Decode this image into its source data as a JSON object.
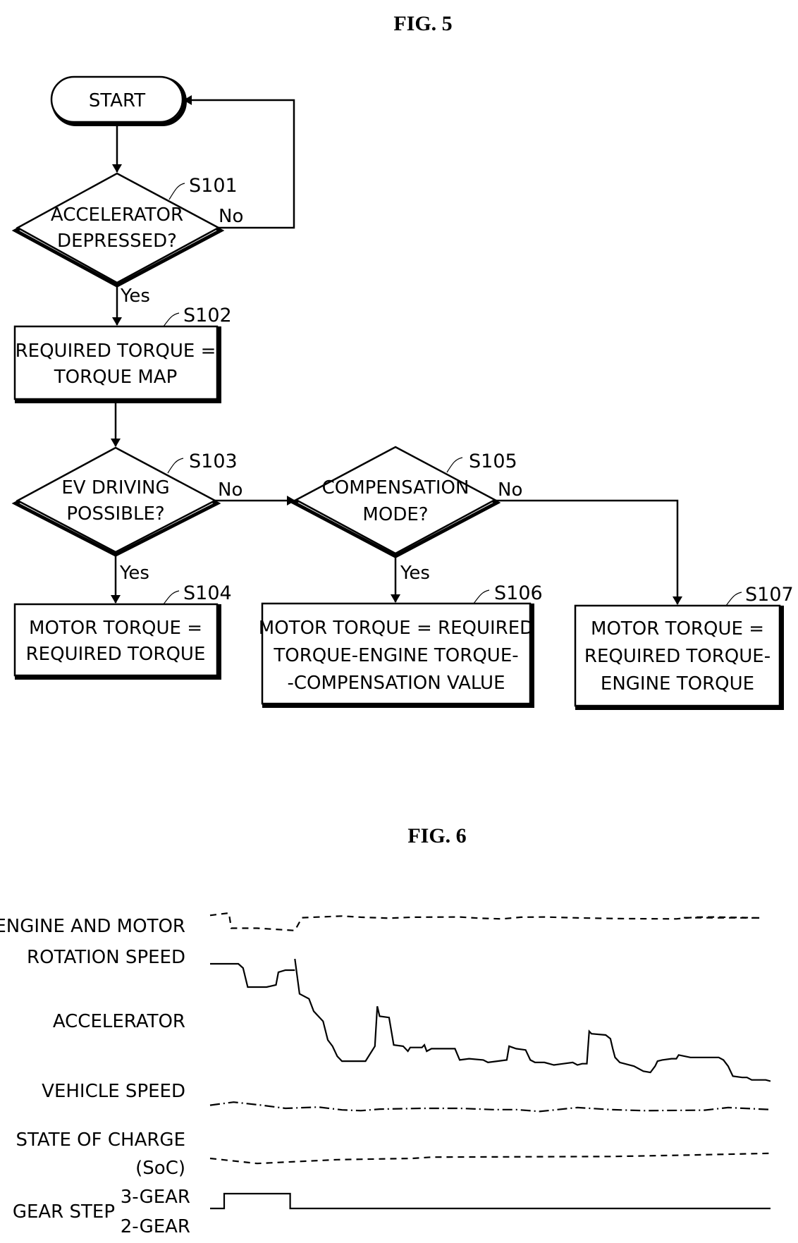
{
  "figures": {
    "fig5": {
      "title": "FIG. 5",
      "nodes": {
        "start": {
          "text": "START"
        },
        "s101": {
          "step": "S101",
          "lines": [
            "ACCELERATOR",
            "DEPRESSED?"
          ],
          "yes": "Yes",
          "no": "No"
        },
        "s102": {
          "step": "S102",
          "lines": [
            "REQUIRED TORQUE =",
            "TORQUE MAP"
          ]
        },
        "s103": {
          "step": "S103",
          "lines": [
            "EV DRIVING",
            "POSSIBLE?"
          ],
          "yes": "Yes",
          "no": "No"
        },
        "s104": {
          "step": "S104",
          "lines": [
            "MOTOR TORQUE =",
            "REQUIRED TORQUE"
          ]
        },
        "s105": {
          "step": "S105",
          "lines": [
            "COMPENSATION",
            "MODE?"
          ],
          "yes": "Yes",
          "no": "No"
        },
        "s106": {
          "step": "S106",
          "lines": [
            "MOTOR TORQUE = REQUIRED",
            "TORQUE-ENGINE TORQUE-",
            "-COMPENSATION VALUE"
          ]
        },
        "s107": {
          "step": "S107",
          "lines": [
            "MOTOR TORQUE =",
            "REQUIRED TORQUE-",
            "ENGINE TORQUE"
          ]
        }
      }
    },
    "fig6": {
      "title": "FIG. 6",
      "labels": {
        "rotation_speed": [
          "ENGINE AND MOTOR",
          "ROTATION SPEED"
        ],
        "accelerator": "ACCELERATOR",
        "vehicle_speed": "VEHICLE SPEED",
        "soc": [
          "STATE OF CHARGE",
          "(SoC)"
        ],
        "gear_step": "GEAR STEP",
        "gear_high": "3-GEAR",
        "gear_low": "2-GEAR"
      }
    }
  },
  "chart_data": {
    "type": "line",
    "title": "FIG. 6",
    "xlabel": "time (unlabeled)",
    "ylabel": "",
    "note": "Qualitative timing chart; no axis ticks. Values are normalized 0-1 within each signal's band (1 = top of band), x in 0-100 normalized time.",
    "series": [
      {
        "name": "ENGINE AND MOTOR ROTATION SPEED (engine, dashed)",
        "style": "dashed",
        "points": [
          [
            0,
            0.9
          ],
          [
            4,
            1.0
          ],
          [
            4.5,
            0.35
          ],
          [
            10,
            0.35
          ],
          [
            18,
            0.25
          ],
          [
            19.5,
            0.8
          ],
          [
            28,
            0.87
          ],
          [
            32,
            0.82
          ],
          [
            38,
            0.78
          ],
          [
            43,
            0.82
          ],
          [
            53,
            0.83
          ],
          [
            57,
            0.78
          ],
          [
            62,
            0.75
          ],
          [
            66,
            0.82
          ],
          [
            71,
            0.83
          ],
          [
            78,
            0.79
          ],
          [
            87,
            0.76
          ],
          [
            99,
            0.75
          ],
          [
            103,
            0.82
          ],
          [
            107,
            0.83
          ],
          [
            117,
            0.79
          ],
          [
            100,
            0.8
          ]
        ]
      },
      {
        "name": "ENGINE AND MOTOR ROTATION SPEED (motor, solid)",
        "style": "solid",
        "points": [
          [
            0,
            0.55
          ],
          [
            6,
            0.55
          ],
          [
            7,
            0.45
          ],
          [
            8,
            0.0
          ],
          [
            12,
            0.0
          ],
          [
            14,
            0.05
          ],
          [
            14.5,
            0.35
          ],
          [
            16,
            0.4
          ],
          [
            18,
            0.4
          ]
        ]
      },
      {
        "name": "ACCELERATOR",
        "style": "solid",
        "points": [
          [
            18,
            1.0
          ],
          [
            19,
            0.72
          ],
          [
            21,
            0.68
          ],
          [
            22,
            0.58
          ],
          [
            24,
            0.5
          ],
          [
            25,
            0.35
          ],
          [
            26,
            0.3
          ],
          [
            27,
            0.22
          ],
          [
            28,
            0.18
          ],
          [
            33,
            0.18
          ],
          [
            35,
            0.3
          ],
          [
            35.5,
            0.62
          ],
          [
            36,
            0.54
          ],
          [
            38,
            0.53
          ],
          [
            39,
            0.31
          ],
          [
            41,
            0.3
          ],
          [
            42,
            0.26
          ],
          [
            42.5,
            0.29
          ],
          [
            45,
            0.29
          ],
          [
            45.5,
            0.31
          ],
          [
            46,
            0.26
          ],
          [
            47,
            0.28
          ],
          [
            52,
            0.28
          ],
          [
            53,
            0.19
          ],
          [
            55,
            0.2
          ],
          [
            58,
            0.19
          ],
          [
            59,
            0.17
          ],
          [
            61,
            0.18
          ],
          [
            63,
            0.19
          ],
          [
            63.5,
            0.3
          ],
          [
            65,
            0.28
          ],
          [
            67,
            0.27
          ],
          [
            68,
            0.19
          ],
          [
            69,
            0.17
          ],
          [
            71,
            0.17
          ],
          [
            73,
            0.15
          ],
          [
            75,
            0.16
          ],
          [
            77,
            0.17
          ],
          [
            78,
            0.15
          ],
          [
            79,
            0.16
          ],
          [
            80,
            0.16
          ],
          [
            80.5,
            0.42
          ],
          [
            81,
            0.4
          ],
          [
            84,
            0.39
          ],
          [
            85,
            0.36
          ],
          [
            85.5,
            0.28
          ],
          [
            86,
            0.21
          ],
          [
            87,
            0.17
          ],
          [
            90,
            0.14
          ],
          [
            92,
            0.1
          ],
          [
            93.5,
            0.09
          ],
          [
            94.5,
            0.14
          ],
          [
            95,
            0.18
          ],
          [
            96,
            0.19
          ],
          [
            98,
            0.2
          ],
          [
            99,
            0.2
          ],
          [
            99.5,
            0.23
          ],
          [
            102,
            0.21
          ],
          [
            105,
            0.21
          ],
          [
            108,
            0.21
          ],
          [
            109,
            0.19
          ],
          [
            110,
            0.14
          ],
          [
            111,
            0.06
          ],
          [
            113,
            0.05
          ],
          [
            114,
            0.05
          ],
          [
            115,
            0.03
          ],
          [
            118,
            0.03
          ],
          [
            119,
            0.02
          ]
        ]
      },
      {
        "name": "VEHICLE SPEED",
        "style": "dash-dot",
        "points": [
          [
            0,
            0.7
          ],
          [
            5,
            0.9
          ],
          [
            11,
            0.7
          ],
          [
            16,
            0.5
          ],
          [
            23,
            0.58
          ],
          [
            28,
            0.4
          ],
          [
            32,
            0.35
          ],
          [
            36,
            0.45
          ],
          [
            45,
            0.5
          ],
          [
            53,
            0.5
          ],
          [
            60,
            0.42
          ],
          [
            65,
            0.42
          ],
          [
            70,
            0.3
          ],
          [
            78,
            0.55
          ],
          [
            85,
            0.42
          ],
          [
            92,
            0.35
          ],
          [
            105,
            0.38
          ],
          [
            110,
            0.55
          ],
          [
            119,
            0.42
          ]
        ]
      },
      {
        "name": "STATE OF CHARGE (SoC)",
        "style": "dashed",
        "points": [
          [
            0,
            0.5
          ],
          [
            10,
            0.1
          ],
          [
            27,
            0.4
          ],
          [
            43,
            0.5
          ],
          [
            47,
            0.6
          ],
          [
            63,
            0.62
          ],
          [
            85,
            0.65
          ],
          [
            100,
            0.75
          ],
          [
            119,
            0.9
          ]
        ]
      },
      {
        "name": "GEAR STEP",
        "style": "solid",
        "levels": [
          "2-GEAR",
          "3-GEAR"
        ],
        "points": [
          [
            0,
            "2-GEAR"
          ],
          [
            3,
            "2-GEAR"
          ],
          [
            3,
            "3-GEAR"
          ],
          [
            17,
            "3-GEAR"
          ],
          [
            17,
            "2-GEAR"
          ],
          [
            119,
            "2-GEAR"
          ]
        ]
      }
    ]
  }
}
